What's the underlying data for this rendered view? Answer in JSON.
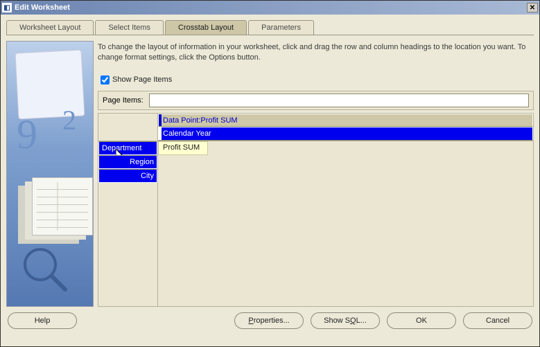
{
  "window": {
    "title": "Edit Worksheet"
  },
  "tabs": [
    {
      "label": "Worksheet Layout"
    },
    {
      "label": "Select Items"
    },
    {
      "label": "Crosstab Layout"
    },
    {
      "label": "Parameters"
    }
  ],
  "instructions": "To change the layout of information in your worksheet, click and drag the row and column headings to the location you want. To change format settings, click the Options button.",
  "checkbox": {
    "label": "Show Page Items",
    "checked": true
  },
  "pageitems": {
    "label": "Page Items:"
  },
  "crosstab": {
    "col_headers": [
      "Data Point:Profit SUM",
      "Calendar Year"
    ],
    "row_headers": [
      "Department",
      "Region",
      "City"
    ],
    "data_cell": "Profit SUM"
  },
  "buttons": {
    "help": "Help",
    "properties": "Properties...",
    "showsql": "Show SQL...",
    "ok": "OK",
    "cancel": "Cancel"
  }
}
